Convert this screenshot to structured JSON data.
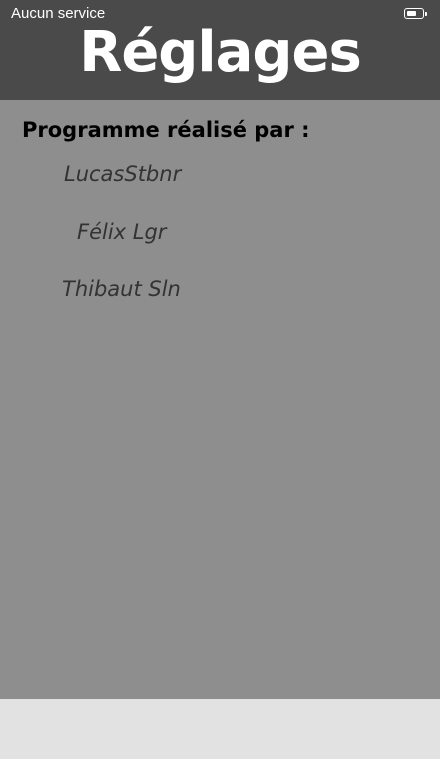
{
  "status_bar": {
    "carrier": "Aucun service",
    "battery_icon": "battery-icon"
  },
  "header": {
    "title": "Réglages"
  },
  "credits": {
    "heading": "Programme réalisé par :",
    "names": [
      "LucasStbnr",
      "Félix Lgr",
      "Thibaut Sln"
    ]
  },
  "colors": {
    "header_bg": "#4a4a4a",
    "content_bg": "#8e8e8e",
    "footer_bg": "#e2e2e2",
    "name_text": "#333333"
  }
}
